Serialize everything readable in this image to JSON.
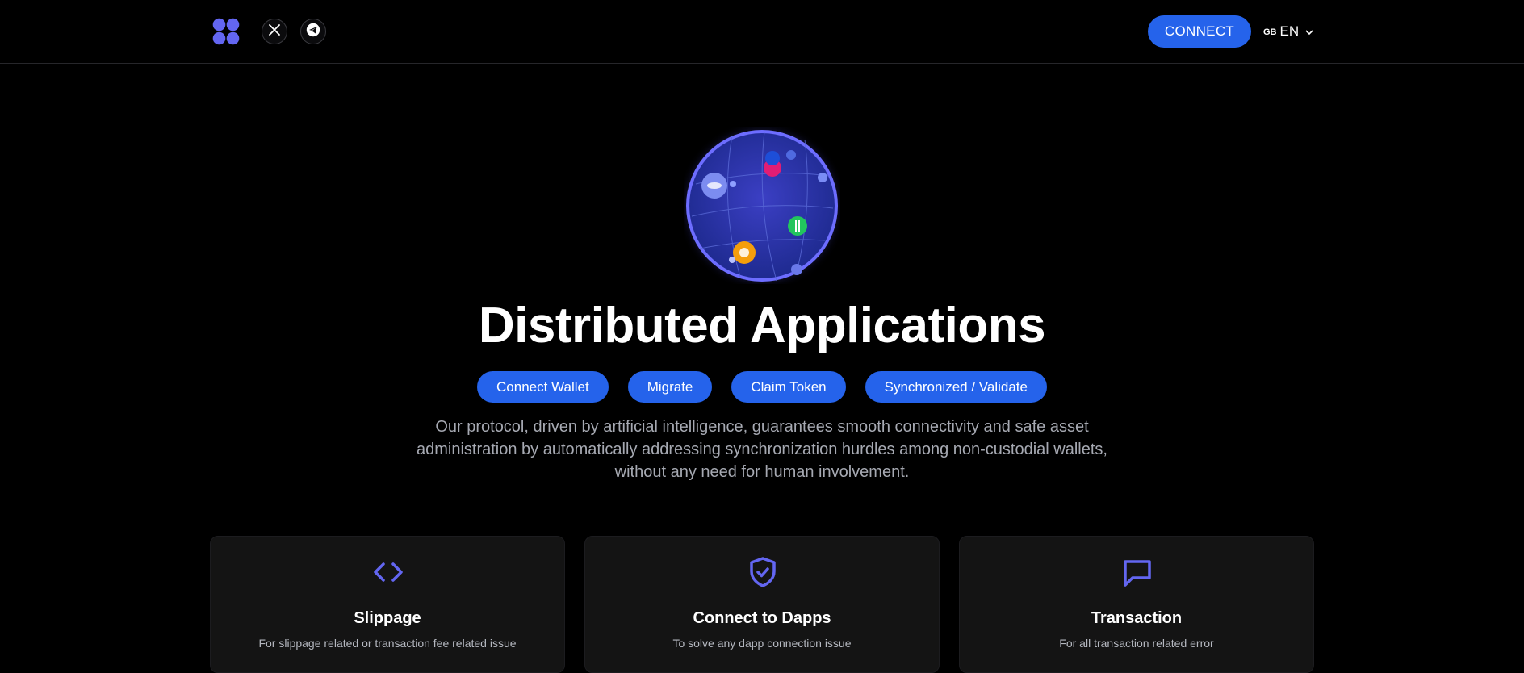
{
  "header": {
    "logo_icon": "four-circles-logo",
    "social_links": [
      {
        "icon": "x-twitter-icon"
      },
      {
        "icon": "telegram-icon"
      }
    ],
    "connect_label": "CONNECT",
    "language": {
      "flag": "GB",
      "code": "EN"
    }
  },
  "hero": {
    "globe_icon": "globe-with-tokens",
    "title": "Distributed Applications",
    "actions": [
      "Connect Wallet",
      "Migrate",
      "Claim Token",
      "Synchronized / Validate"
    ],
    "description": "Our protocol, driven by artificial intelligence, guarantees smooth connectivity and safe asset administration by automatically addressing synchronization hurdles among non-custodial wallets, without any need for human involvement."
  },
  "cards": [
    {
      "icon": "code-brackets-icon",
      "title": "Slippage",
      "subtitle": "For slippage related or transaction fee related issue"
    },
    {
      "icon": "shield-check-icon",
      "title": "Connect to Dapps",
      "subtitle": "To solve any dapp connection issue"
    },
    {
      "icon": "chat-bubble-icon",
      "title": "Transaction",
      "subtitle": "For all transaction related error"
    }
  ],
  "colors": {
    "accent": "#2563eb",
    "icon_purple": "#6366f1",
    "card_bg": "#141414",
    "text_muted": "#a6a9b2"
  }
}
